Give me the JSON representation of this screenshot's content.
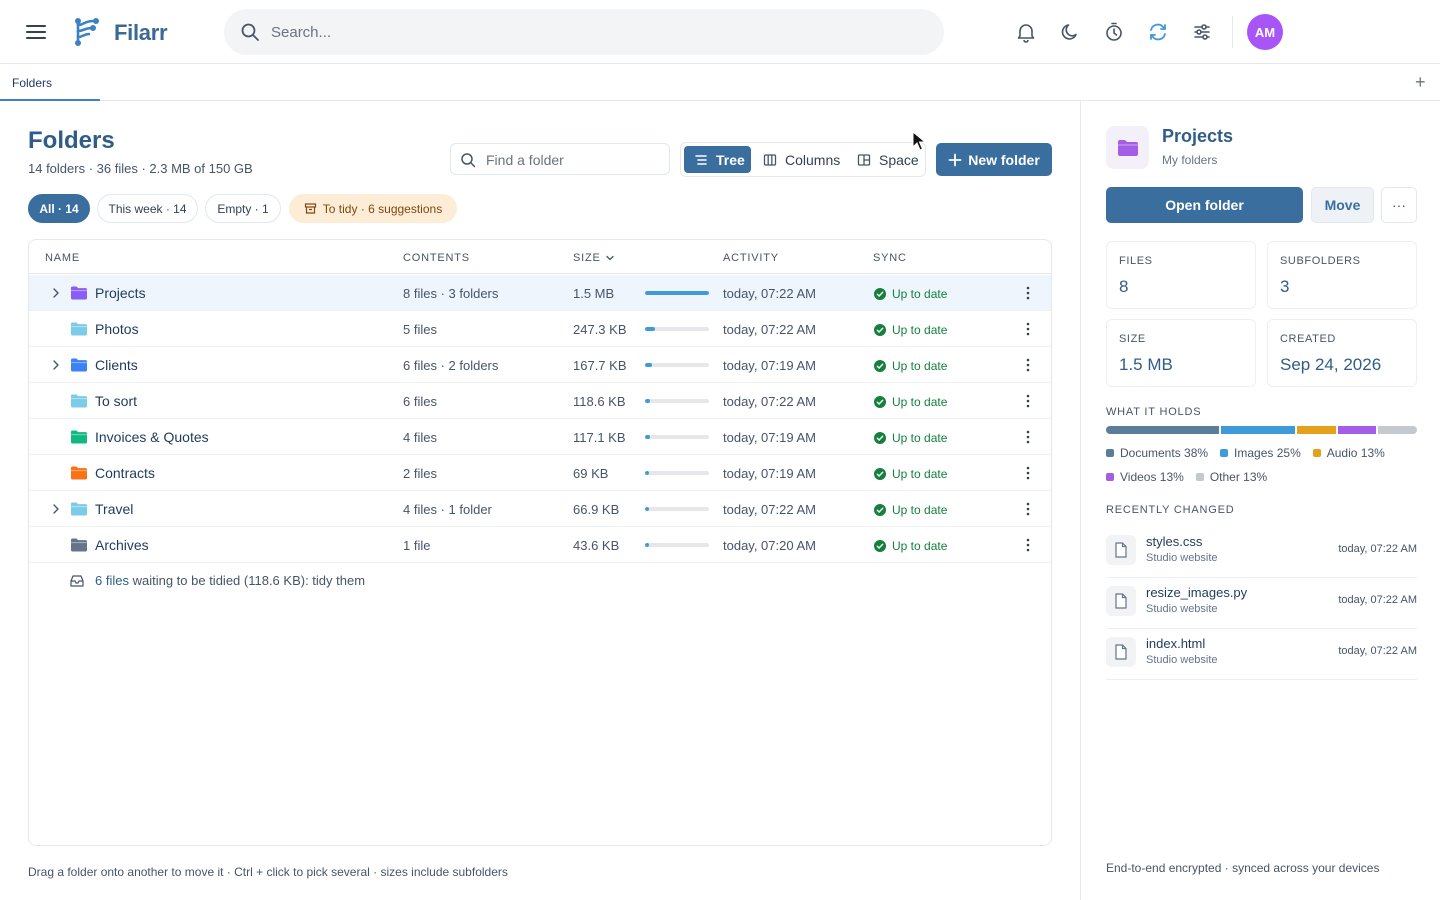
{
  "header": {
    "brand": "Filarr",
    "search_placeholder": "Search...",
    "avatar_initials": "AM",
    "accent": "#3a6e9e"
  },
  "tabs": [
    {
      "label": "Folders"
    }
  ],
  "main": {
    "title": "Folders",
    "summary": "14 folders · 36 files · 2.3 MB of 150 GB",
    "find_placeholder": "Find a folder",
    "views": [
      "Tree",
      "Columns",
      "Space"
    ],
    "active_view": "Tree",
    "new_folder_label": "New folder",
    "filters": [
      {
        "label": "All · 14",
        "active": true
      },
      {
        "label": "This week · 14"
      },
      {
        "label": "Empty · 1"
      },
      {
        "label": "To tidy · 6 suggestions",
        "warn": true
      }
    ],
    "columns": {
      "name": "NAME",
      "contents": "CONTENTS",
      "size": "SIZE",
      "activity": "ACTIVITY",
      "sync": "SYNC"
    },
    "rows": [
      {
        "name": "Projects",
        "contents": "8 files · 3 folders",
        "size": "1.5 MB",
        "fill": 1.0,
        "activity": "today, 07:22 AM",
        "sync": "Up to date",
        "color": "#8b5cf6",
        "expandable": true,
        "selected": true
      },
      {
        "name": "Photos",
        "contents": "5 files",
        "size": "247.3 KB",
        "fill": 0.16,
        "activity": "today, 07:22 AM",
        "sync": "Up to date",
        "color": "#7ccbe8",
        "expandable": false
      },
      {
        "name": "Clients",
        "contents": "6 files · 2 folders",
        "size": "167.7 KB",
        "fill": 0.11,
        "activity": "today, 07:19 AM",
        "sync": "Up to date",
        "color": "#3b82f6",
        "expandable": true
      },
      {
        "name": "To sort",
        "contents": "6 files",
        "size": "118.6 KB",
        "fill": 0.08,
        "activity": "today, 07:22 AM",
        "sync": "Up to date",
        "color": "#7ccbe8",
        "expandable": false
      },
      {
        "name": "Invoices & Quotes",
        "contents": "4 files",
        "size": "117.1 KB",
        "fill": 0.08,
        "activity": "today, 07:19 AM",
        "sync": "Up to date",
        "color": "#10b981",
        "expandable": false
      },
      {
        "name": "Contracts",
        "contents": "2 files",
        "size": "69 KB",
        "fill": 0.05,
        "activity": "today, 07:19 AM",
        "sync": "Up to date",
        "color": "#f97316",
        "expandable": false
      },
      {
        "name": "Travel",
        "contents": "4 files · 1 folder",
        "size": "66.9 KB",
        "fill": 0.04,
        "activity": "today, 07:22 AM",
        "sync": "Up to date",
        "color": "#7ccbe8",
        "expandable": true
      },
      {
        "name": "Archives",
        "contents": "1 file",
        "size": "43.6 KB",
        "fill": 0.03,
        "activity": "today, 07:20 AM",
        "sync": "Up to date",
        "color": "#64748b",
        "expandable": false
      }
    ],
    "tidy_link": "6 files",
    "tidy_text": "waiting to be tidied (118.6 KB): tidy them",
    "hint": "Drag a folder onto another to move it · Ctrl + click to pick several · sizes include subfolders"
  },
  "panel": {
    "title": "Projects",
    "subtitle": "My folders",
    "open_label": "Open folder",
    "move_label": "Move",
    "more_label": "···",
    "stats": [
      {
        "key": "FILES",
        "value": "8"
      },
      {
        "key": "SUBFOLDERS",
        "value": "3"
      },
      {
        "key": "SIZE",
        "value": "1.5 MB"
      },
      {
        "key": "CREATED",
        "value": "Sep 24, 2026"
      }
    ],
    "holds_title": "WHAT IT HOLDS",
    "composition": [
      {
        "label": "Documents 38%",
        "share": 38,
        "color": "#5a7d99"
      },
      {
        "label": "Images 25%",
        "share": 25,
        "color": "#3e9bd8"
      },
      {
        "label": "Audio 13%",
        "share": 13,
        "color": "#e5a11a"
      },
      {
        "label": "Videos 13%",
        "share": 13,
        "color": "#a45ee5"
      },
      {
        "label": "Other 13%",
        "share": 13,
        "color": "#c4c8cf"
      }
    ],
    "recent_title": "RECENTLY CHANGED",
    "recent": [
      {
        "file": "styles.css",
        "project": "Studio website",
        "time": "today, 07:22 AM"
      },
      {
        "file": "resize_images.py",
        "project": "Studio website",
        "time": "today, 07:22 AM"
      },
      {
        "file": "index.html",
        "project": "Studio website",
        "time": "today, 07:22 AM"
      }
    ],
    "footer": "End-to-end encrypted · synced across your devices"
  }
}
